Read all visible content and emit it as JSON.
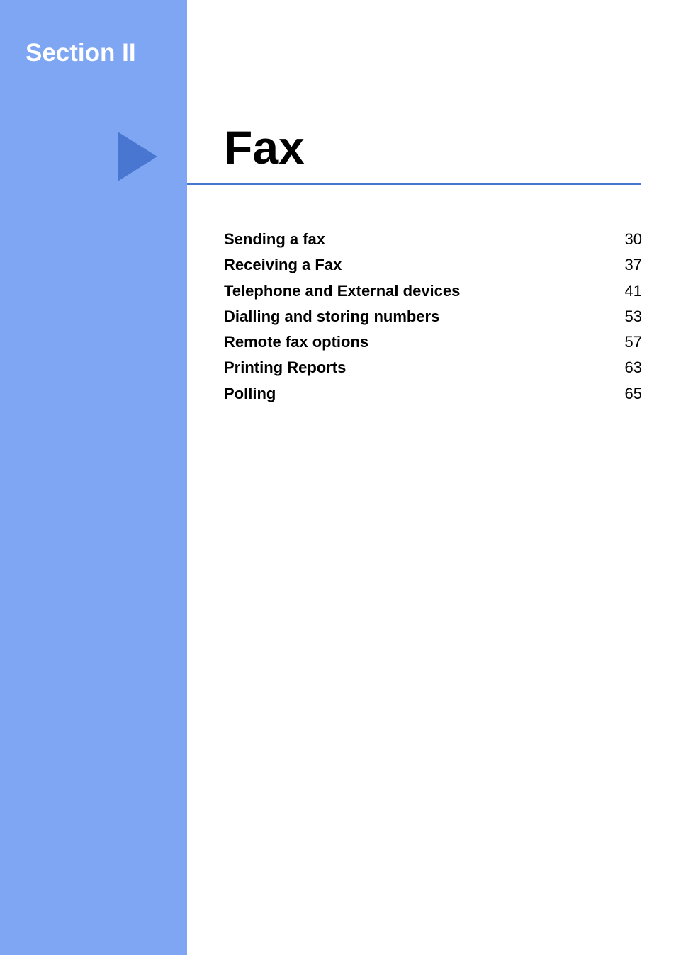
{
  "section_label": "Section II",
  "heading": "Fax",
  "toc": [
    {
      "label": "Sending a fax",
      "page": "30"
    },
    {
      "label": "Receiving a Fax",
      "page": "37"
    },
    {
      "label": "Telephone and External devices",
      "page": "41"
    },
    {
      "label": "Dialling and storing numbers",
      "page": "53"
    },
    {
      "label": "Remote fax options",
      "page": "57"
    },
    {
      "label": "Printing Reports",
      "page": "63"
    },
    {
      "label": "Polling",
      "page": "65"
    }
  ]
}
